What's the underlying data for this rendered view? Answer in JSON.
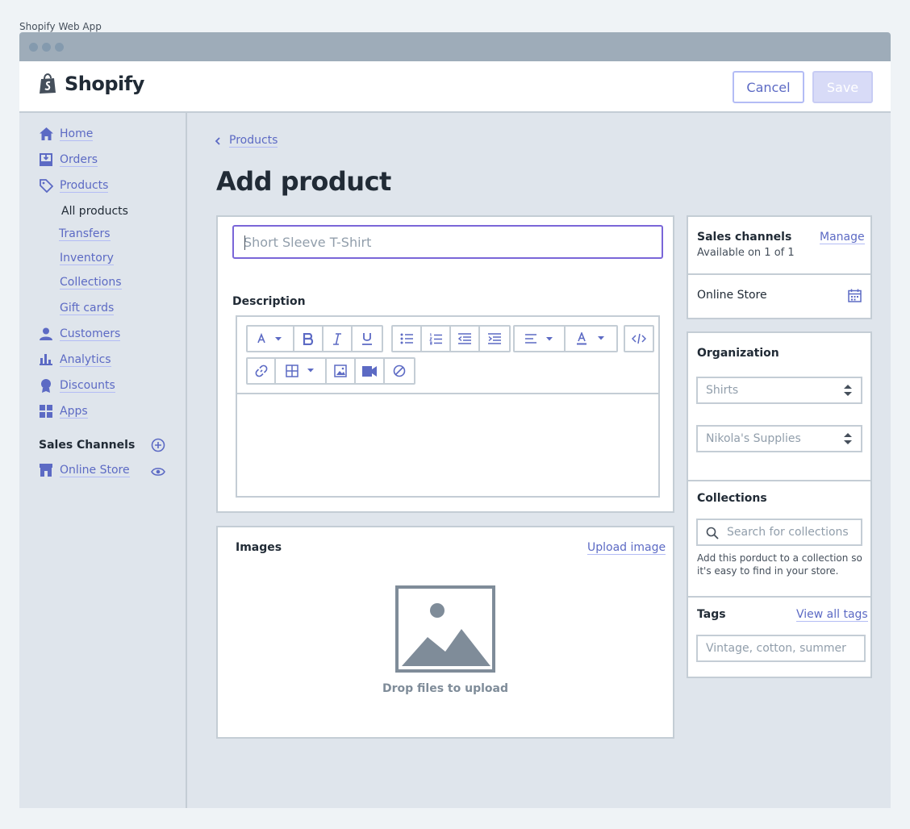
{
  "window_caption": "Shopify Web App",
  "brand": {
    "name": "Shopify",
    "accent": "#5c6ac4"
  },
  "header": {
    "cancel_label": "Cancel",
    "save_label": "Save"
  },
  "sidebar": {
    "items": [
      {
        "label": "Home",
        "icon": "home-icon"
      },
      {
        "label": "Orders",
        "icon": "orders-icon"
      },
      {
        "label": "Products",
        "icon": "tag-icon"
      }
    ],
    "product_subitems": [
      "All products",
      "Transfers",
      "Inventory",
      "Collections",
      "Gift cards"
    ],
    "items_after": [
      {
        "label": "Customers",
        "icon": "person-icon"
      },
      {
        "label": "Analytics",
        "icon": "bar-chart-icon"
      },
      {
        "label": "Discounts",
        "icon": "discount-icon"
      },
      {
        "label": "Apps",
        "icon": "apps-grid-icon"
      }
    ],
    "sales_channels_heading": "Sales Channels",
    "online_store_label": "Online Store"
  },
  "breadcrumb": {
    "label": "Products"
  },
  "page_title": "Add product",
  "product_form": {
    "title_placeholder": "Short Sleeve T-Shirt",
    "description_label": "Description"
  },
  "images": {
    "heading": "Images",
    "upload_link": "Upload image",
    "drop_text": "Drop files to upload"
  },
  "sales_channels": {
    "heading": "Sales Channels",
    "heading_display": "Sales channels",
    "manage_link": "Manage",
    "availability": "Available on 1 of 1",
    "channel": "Online Store"
  },
  "organization": {
    "heading": "Organization",
    "product_type": "Shirts",
    "vendor": "Nikola's Supplies"
  },
  "collections": {
    "heading": "Collections",
    "search_placeholder": "Search for collections",
    "help_line1": "Add this porduct to a collection so",
    "help_line2": "it's easy to find in your store."
  },
  "tags": {
    "heading": "Tags",
    "view_all_link": "View all tags",
    "placeholder": "Vintage, cotton, summer"
  }
}
